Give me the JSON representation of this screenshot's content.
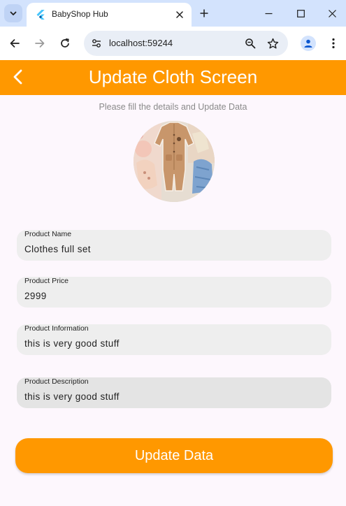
{
  "browser": {
    "tab_title": "BabyShop Hub",
    "url": "localhost:59244",
    "icons": {
      "tab_search": "chevron-down-icon",
      "favicon": "flutter-icon",
      "tab_close": "close-icon",
      "new_tab": "plus-icon",
      "minimize": "minimize-icon",
      "maximize": "maximize-icon",
      "close_window": "close-icon",
      "back": "arrow-left-icon",
      "forward": "arrow-right-icon",
      "reload": "reload-icon",
      "site_info": "tune-icon",
      "zoom": "zoom-icon",
      "bookmark": "star-icon",
      "profile": "person-icon",
      "menu": "kebab-menu-icon"
    }
  },
  "app": {
    "title": "Update Cloth Screen",
    "subtitle": "Please fill the details and Update Data",
    "back_icon": "chevron-left-icon",
    "product_image": "baby-clothes-set-image",
    "fields": {
      "name": {
        "label": "Product Name",
        "value": "Clothes full set"
      },
      "price": {
        "label": "Product Price",
        "value": "2999"
      },
      "information": {
        "label": "Product Information",
        "value": "this is very good stuff"
      },
      "description": {
        "label": "Product Description",
        "value": "this is very good stuff"
      }
    },
    "button_label": "Update Data"
  },
  "colors": {
    "accent": "#ff9800",
    "background": "#fdf7fd",
    "field_bg": "#eeeeee",
    "subtitle": "#8a8a8a",
    "tabbar": "#d3e3fd"
  }
}
